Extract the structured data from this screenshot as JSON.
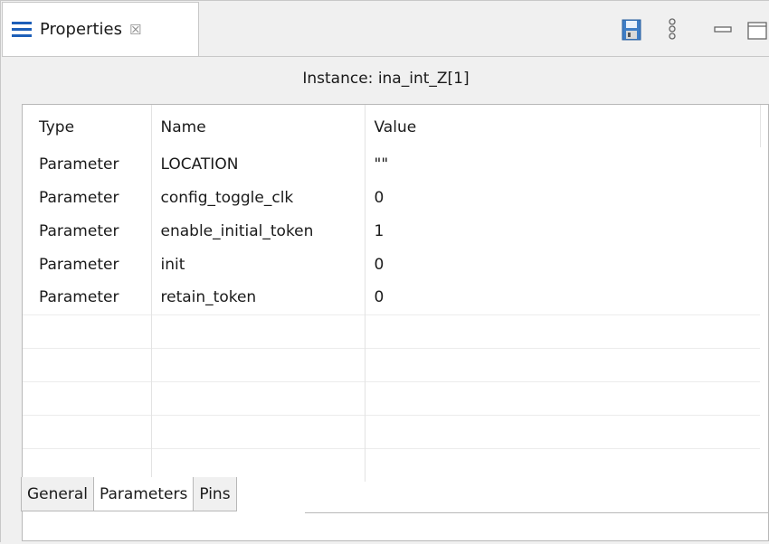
{
  "view": {
    "tab_label": "Properties",
    "icons": {
      "menu": "hamburger-icon",
      "close": "close-icon",
      "save": "save-icon",
      "more": "kebab-icon",
      "minimize": "minimize-icon",
      "maximize": "maximize-icon"
    },
    "accent_color": "#1d5fb8"
  },
  "instance": {
    "title": "Instance: ina_int_Z[1]"
  },
  "table": {
    "headers": [
      "Type",
      "Name",
      "Value"
    ],
    "rows": [
      [
        "Parameter",
        "LOCATION",
        "\"\""
      ],
      [
        "Parameter",
        "config_toggle_clk",
        "0"
      ],
      [
        "Parameter",
        "enable_initial_token",
        "1"
      ],
      [
        "Parameter",
        "init",
        "0"
      ],
      [
        "Parameter",
        "retain_token",
        "0"
      ]
    ]
  },
  "bottom_tabs": [
    "General",
    "Parameters",
    "Pins"
  ],
  "active_bottom_tab": "Parameters"
}
